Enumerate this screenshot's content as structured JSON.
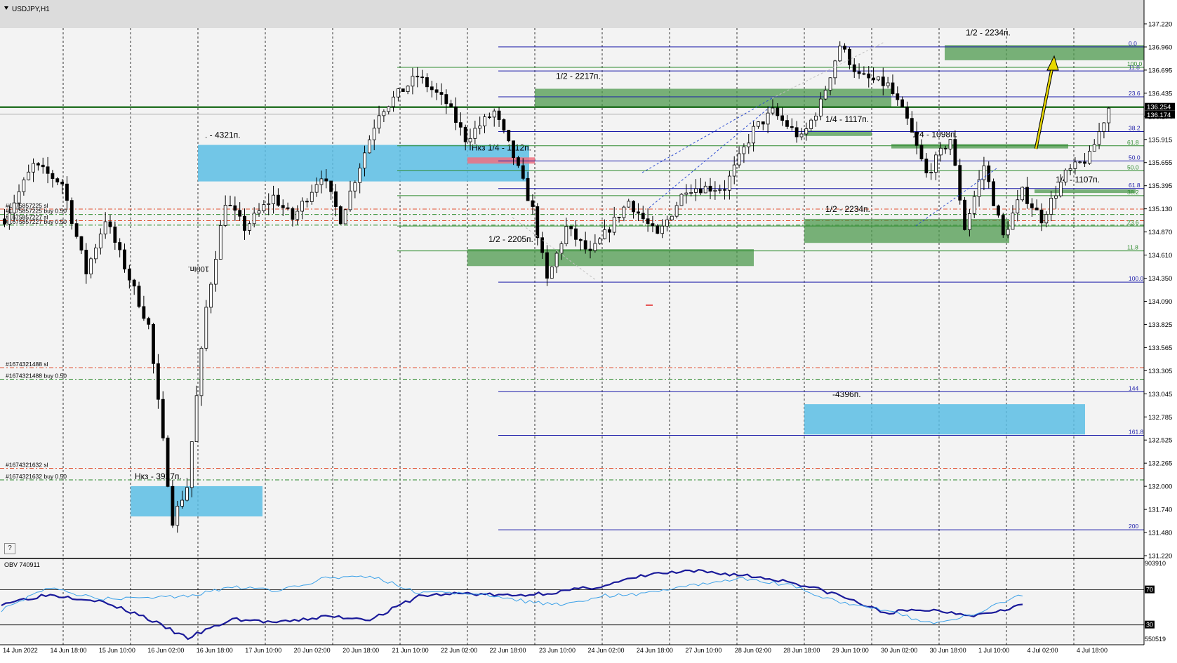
{
  "symbol_title": "USDJPY,H1",
  "help_label": "?",
  "colors": {
    "price_box_bg": "#000000",
    "price_box_text": "#ffffff",
    "green_zone": "#4e9a4e",
    "blue_zone": "#5bbde4",
    "red_zone": "#f07080",
    "fib_line": "#1a1aa8",
    "green_line": "#2e8b2e",
    "bid_line": "#005a00",
    "arrow": "#e8d800",
    "obv_dark": "#1a1a9a",
    "obv_light": "#3aa0e8"
  },
  "chart_data": [
    {
      "type": "candlestick",
      "symbol": "USDJPY",
      "timeframe": "H1",
      "title": "USDJPY,H1",
      "ylim": [
        131.22,
        137.22
      ],
      "price_ticks": [
        "137.220",
        "136.960",
        "136.695",
        "136.435",
        "136.174",
        "135.915",
        "135.655",
        "135.395",
        "135.130",
        "134.870",
        "134.610",
        "134.350",
        "134.090",
        "133.825",
        "133.565",
        "133.305",
        "133.045",
        "132.785",
        "132.525",
        "132.265",
        "132.000",
        "131.740",
        "131.480",
        "131.220"
      ],
      "current_prices": {
        "ask": "136.254",
        "bid": "136.174"
      },
      "time_labels": [
        "14 Jun 2022",
        "14 Jun 18:00",
        "15 Jun 10:00",
        "16 Jun 02:00",
        "16 Jun 18:00",
        "17 Jun 10:00",
        "20 Jun 02:00",
        "20 Jun 18:00",
        "21 Jun 10:00",
        "22 Jun 02:00",
        "22 Jun 18:00",
        "23 Jun 10:00",
        "24 Jun 02:00",
        "24 Jun 18:00",
        "27 Jun 10:00",
        "28 Jun 02:00",
        "28 Jun 18:00",
        "29 Jun 10:00",
        "30 Jun 02:00",
        "30 Jun 18:00",
        "1 Jul 10:00",
        "4 Jul 02:00",
        "4 Jul 18:00"
      ],
      "price_path": [
        [
          0,
          135.0
        ],
        [
          6,
          135.6
        ],
        [
          12,
          135.4
        ],
        [
          17,
          134.4
        ],
        [
          21,
          135.0
        ],
        [
          30,
          133.8
        ],
        [
          35,
          131.62
        ],
        [
          38,
          132.0
        ],
        [
          42,
          134.0
        ],
        [
          46,
          135.2
        ],
        [
          50,
          134.9
        ],
        [
          56,
          135.25
        ],
        [
          60,
          135.0
        ],
        [
          66,
          135.5
        ],
        [
          70,
          135.0
        ],
        [
          78,
          136.2
        ],
        [
          86,
          136.6
        ],
        [
          92,
          136.3
        ],
        [
          96,
          135.9
        ],
        [
          102,
          136.2
        ],
        [
          106,
          135.7
        ],
        [
          110,
          135.1
        ],
        [
          113,
          134.3
        ],
        [
          117,
          134.9
        ],
        [
          122,
          134.6
        ],
        [
          130,
          135.2
        ],
        [
          136,
          134.8
        ],
        [
          142,
          135.35
        ],
        [
          150,
          135.35
        ],
        [
          156,
          136.0
        ],
        [
          160,
          136.2
        ],
        [
          166,
          135.9
        ],
        [
          170,
          136.3
        ],
        [
          174,
          136.95
        ],
        [
          178,
          136.6
        ],
        [
          184,
          136.5
        ],
        [
          188,
          136.1
        ],
        [
          192,
          135.5
        ],
        [
          197,
          135.9
        ],
        [
          200,
          134.9
        ],
        [
          204,
          135.6
        ],
        [
          208,
          134.8
        ],
        [
          212,
          135.3
        ],
        [
          216,
          135.0
        ],
        [
          221,
          135.5
        ],
        [
          226,
          135.7
        ],
        [
          230,
          136.25
        ]
      ],
      "fib_left": {
        "levels": [
          {
            "label": "0.0",
            "price": 136.93
          },
          {
            "label": "11.8",
            "price": 136.66
          },
          {
            "label": "23.6",
            "price": 136.37
          },
          {
            "label": "38.2",
            "price": 135.98
          },
          {
            "label": "50.0",
            "price": 135.65
          },
          {
            "label": "61.8",
            "price": 135.34
          },
          {
            "label": "100.0",
            "price": 134.29
          },
          {
            "label": "144",
            "price": 133.06
          },
          {
            "label": "161.8",
            "price": 132.57
          },
          {
            "label": "200",
            "price": 131.51
          }
        ]
      },
      "fib_right": {
        "levels": [
          {
            "label": "100.0",
            "price": 136.7
          },
          {
            "label": "61.8",
            "price": 135.82
          },
          {
            "label": "50.0",
            "price": 135.54
          },
          {
            "label": "38.2",
            "price": 135.26
          },
          {
            "label": "23.6",
            "price": 134.92
          },
          {
            "label": "11.8",
            "price": 134.64
          }
        ]
      },
      "zones": [
        {
          "kind": "green",
          "label": "1/2 - 2217п.",
          "price_top": 136.46,
          "price_bottom": 136.26
        },
        {
          "kind": "green",
          "label": "1/2 - 2234п.",
          "price_top": 136.95,
          "price_bottom": 136.78
        },
        {
          "kind": "green",
          "label": "1/4 - 1117п.",
          "price_top": 135.99,
          "price_bottom": 135.93
        },
        {
          "kind": "green",
          "label": "1/4 - 1098п.",
          "price_top": 135.84,
          "price_bottom": 135.79
        },
        {
          "kind": "green",
          "label": "1/4 - 1107п.",
          "price_top": 135.33,
          "price_bottom": 135.29
        },
        {
          "kind": "green",
          "label": "1/2 - 2234п.",
          "price_top": 135.0,
          "price_bottom": 134.73
        },
        {
          "kind": "green",
          "label": "1/2 - 2205п.",
          "price_top": 134.66,
          "price_bottom": 134.47
        },
        {
          "kind": "blue",
          "label": ". - 4321п.",
          "price_top": 135.83,
          "price_bottom": 135.42
        },
        {
          "kind": "blue",
          "label": "-4396п.",
          "price_top": 132.92,
          "price_bottom": 132.58
        },
        {
          "kind": "blue",
          "label": "Нкз - 3927п.",
          "price_top": 132.0,
          "price_bottom": 131.66
        },
        {
          "kind": "red",
          "label": "Нкз 1/4 - 1112п.",
          "price_top": 135.69,
          "price_bottom": 135.62
        }
      ],
      "orders": [
        {
          "label": "#1675857225 sl",
          "price": 135.11,
          "style": "red"
        },
        {
          "label": "#1675857225 buy 0.50",
          "price": 135.05,
          "style": "green"
        },
        {
          "label": "#1675857227 sl",
          "price": 134.98,
          "style": "red"
        },
        {
          "label": "#1675857227 buy 0.50",
          "price": 134.93,
          "style": "green"
        },
        {
          "label": "#1674321488 sl",
          "price": 133.33,
          "style": "red"
        },
        {
          "label": "#1674321488 buy 0.50",
          "price": 133.2,
          "style": "green"
        },
        {
          "label": "#1674321632 sl",
          "price": 132.2,
          "style": "red"
        },
        {
          "label": "#1674321632 buy 0.50",
          "price": 132.07,
          "style": "green"
        }
      ],
      "annotation_rotated": "100Iп."
    },
    {
      "type": "line",
      "title": "OBV 740911",
      "series": [
        {
          "name": "OBV 740911",
          "values": [
            0.42,
            0.56,
            0.48,
            0.24,
            -0.12,
            0.18,
            0.12,
            0.22,
            0.18,
            0.54,
            0.58,
            0.54,
            0.6,
            0.7,
            0.88,
            0.92,
            0.86,
            0.76,
            0.56,
            0.28,
            0.32,
            0.24,
            0.4
          ]
        },
        {
          "values": [
            0.32,
            0.68,
            0.5,
            0.5,
            0.54,
            0.68,
            0.62,
            0.82,
            0.84,
            0.58,
            0.6,
            0.48,
            0.4,
            0.54,
            0.58,
            0.72,
            0.8,
            0.7,
            0.46,
            0.32,
            0.12,
            0.26,
            0.56
          ]
        }
      ],
      "levels": [
        "70",
        "30"
      ],
      "scale_labels": [
        "903910",
        "550519"
      ]
    }
  ]
}
